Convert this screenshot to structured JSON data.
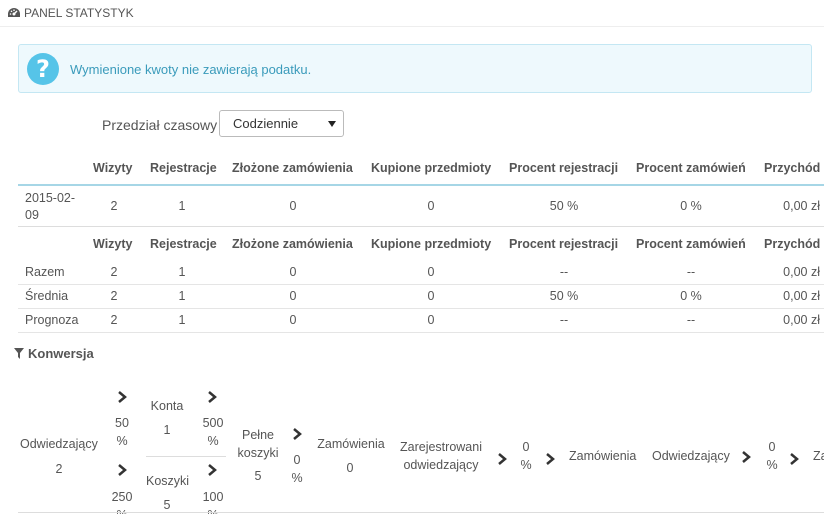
{
  "header": {
    "title": "PANEL STATYSTYK"
  },
  "alert": {
    "message": "Wymienione kwoty nie zawierają podatku."
  },
  "range": {
    "label": "Przedział czasowy",
    "selected": "Codziennie"
  },
  "columns": [
    "Wizyty",
    "Rejestracje",
    "Złożone zamówienia",
    "Kupione przedmioty",
    "Procent rejestracji",
    "Procent zamówień",
    "Przychód"
  ],
  "daily_row": {
    "date_line1": "2015-02-",
    "date_line2": "09",
    "values": [
      "2",
      "1",
      "0",
      "0",
      "50 %",
      "0 %",
      "0,00 zł"
    ]
  },
  "summary_rows": [
    {
      "label": "Razem",
      "values": [
        "2",
        "1",
        "0",
        "0",
        "--",
        "--",
        "0,00 zł"
      ]
    },
    {
      "label": "Średnia",
      "values": [
        "2",
        "1",
        "0",
        "0",
        "50 %",
        "0 %",
        "0,00 zł"
      ]
    },
    {
      "label": "Prognoza",
      "values": [
        "2",
        "1",
        "0",
        "0",
        "--",
        "--",
        "0,00 zł"
      ]
    }
  ],
  "conversion": {
    "title": "Konwersja",
    "visitors_label": "Odwiedzający",
    "visitors_value": "2",
    "pct_accounts": "50",
    "pct_accounts_unit": "%",
    "pct_carts": "250",
    "pct_carts_unit": "%",
    "accounts_label": "Konta",
    "accounts_value": "1",
    "carts_label": "Koszyki",
    "carts_value": "5",
    "pct_500": "500",
    "pct_500_unit": "%",
    "pct_100": "100",
    "pct_100_unit": "%",
    "full_carts_line1": "Pełne",
    "full_carts_line2": "koszyki",
    "full_carts_value": "5",
    "pct_0a": "0",
    "pct_0a_unit": "%",
    "orders_label": "Zamówienia",
    "orders_value": "0",
    "registered_line1": "Zarejestrowani",
    "registered_line2": "odwiedzający",
    "pct_0b": "0",
    "pct_0b_unit": "%",
    "orders2_label": "Zamówienia",
    "visitors2_label": "Odwiedzający",
    "pct_0c": "0",
    "pct_0c_unit": "%",
    "trailing_label": "Za"
  }
}
